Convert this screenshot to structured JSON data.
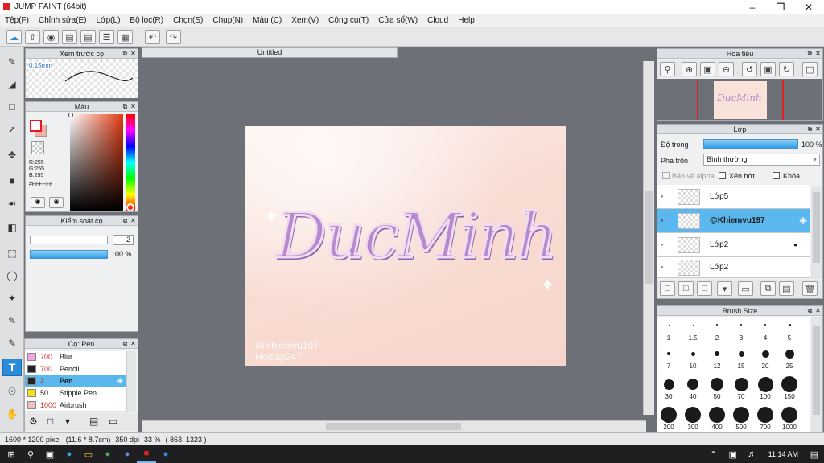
{
  "app": {
    "title": "JUMP PAINT (64bit)"
  },
  "menu": [
    "Tệp(F)",
    "Chỉnh sửa(E)",
    "Lớp(L)",
    "Bộ lọc(R)",
    "Chọn(S)",
    "Chụp(N)",
    "Màu (C)",
    "Xem(V)",
    "Công cụ(T)",
    "Cửa sổ(W)",
    "Cloud",
    "Help"
  ],
  "document": {
    "tab": "Untitled",
    "artwork_text": "DucMinh",
    "watermark1": "@Khiemvu197",
    "watermark2": "Hoidap247"
  },
  "brush_preview": {
    "title": "Xem trước cọ",
    "size": "0.15mm"
  },
  "color": {
    "title": "Màu",
    "r": "R:255",
    "g": "G:255",
    "b": "B:255",
    "hex": "#FFFFFF",
    "fg": "#e8191d",
    "bg": "#f3b0a6"
  },
  "brush_control": {
    "title": "Kiểm soát cọ",
    "size": "2",
    "opacity": "100 %"
  },
  "brush_list": {
    "title": "Cọ: Pen",
    "items": [
      {
        "size": "700",
        "name": "Blur",
        "color": "#f4a6e3"
      },
      {
        "size": "700",
        "name": "Pencil",
        "color": "#222222"
      },
      {
        "size": "2",
        "name": "Pen",
        "color": "#222222",
        "selected": true
      },
      {
        "size": "50",
        "name": "Stipple Pen",
        "color": "#f2e21a"
      },
      {
        "size": "1000",
        "name": "Airbrush",
        "color": "#f0c0c0"
      }
    ]
  },
  "navigator": {
    "title": "Hoa tiêu"
  },
  "layers": {
    "title": "Lớp",
    "opacity_label": "Độ trong",
    "opacity_value": "100 %",
    "blend_label": "Pha trộn",
    "blend_value": "Bình thường",
    "protect_alpha": "Bảo vệ alpha",
    "clip": "Xén bớt",
    "lock": "Khóa",
    "items": [
      {
        "name": "Lớp5"
      },
      {
        "name": "@Khiemvu197",
        "selected": true
      },
      {
        "name": "Lớp2"
      },
      {
        "name": "Lớp2"
      }
    ]
  },
  "brush_size": {
    "title": "Brush Size",
    "sizes": [
      "1",
      "1.5",
      "2",
      "3",
      "4",
      "5",
      "7",
      "10",
      "12",
      "15",
      "20",
      "25",
      "30",
      "40",
      "50",
      "70",
      "100",
      "150",
      "200",
      "300",
      "400",
      "500",
      "700",
      "1000"
    ]
  },
  "status": {
    "dimensions": "1600 * 1200 pixel",
    "physical": "(11.6 * 8.7cm)",
    "dpi": "350 dpi",
    "zoom": "33 %",
    "coords": "( 863, 1323 )"
  },
  "taskbar": {
    "time": "11:14 AM"
  }
}
